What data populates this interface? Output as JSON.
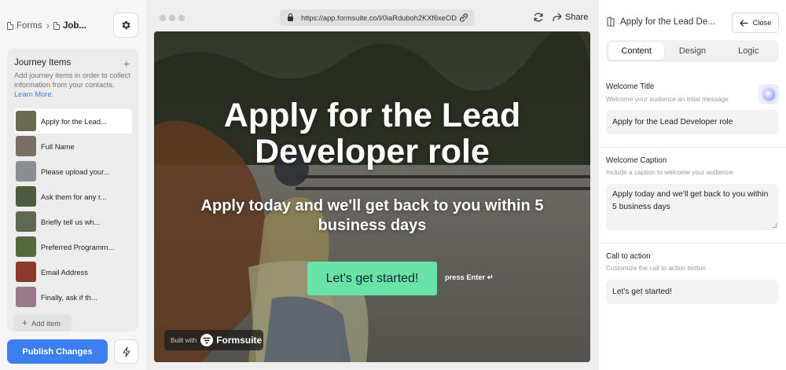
{
  "breadcrumb": {
    "root": "Forms",
    "current": "Job..."
  },
  "journey": {
    "title": "Journey Items",
    "description": "Add journey items in order to collect information from your contacts.",
    "learn_more": "Learn More.",
    "items": [
      {
        "label": "Apply for the Lead...",
        "color": "#6b6a52"
      },
      {
        "label": "Full Name",
        "color": "#7a6f63"
      },
      {
        "label": "Please upload your...",
        "color": "#8b8f94"
      },
      {
        "label": "Ask them for any r...",
        "color": "#4e5b3c"
      },
      {
        "label": "Briefly tell us wh...",
        "color": "#5d6a4f"
      },
      {
        "label": "Preferred Programm...",
        "color": "#56683e"
      },
      {
        "label": "Email Address",
        "color": "#8c3a2c"
      },
      {
        "label": "Finally, ask if th...",
        "color": "#9a7a8a"
      }
    ],
    "add_item": "Add item"
  },
  "publish_label": "Publish Changes",
  "browser": {
    "url": "https://app.formsuite.co/l/0iaRduboh2KXf6xeOD",
    "share": "Share"
  },
  "preview": {
    "title": "Apply for the Lead Developer role",
    "caption": "Apply today and we'll get back to you within 5 business days",
    "cta": "Let's get started!",
    "press_enter": "press Enter ↵",
    "built_with": "Built with",
    "brand": "Formsuite"
  },
  "panel": {
    "title": "Apply for the Lead De...",
    "close": "Close",
    "tabs": [
      "Content",
      "Design",
      "Logic"
    ],
    "welcome_title_label": "Welcome Title",
    "welcome_title_hint": "Welcome your audience an intial message",
    "welcome_title_value": "Apply for the Lead Developer role",
    "welcome_caption_label": "Welcome Caption",
    "welcome_caption_hint": "Include a caption to welcome your audience",
    "welcome_caption_value": "Apply today and we'll get back to you within 5 business days",
    "cta_label": "Call to action",
    "cta_hint": "Customize the call to action button",
    "cta_value": "Let's get started!"
  },
  "colors": {
    "publish": "#3d7ff0",
    "cta": "#69e3a5",
    "link": "#3d7fd6"
  }
}
